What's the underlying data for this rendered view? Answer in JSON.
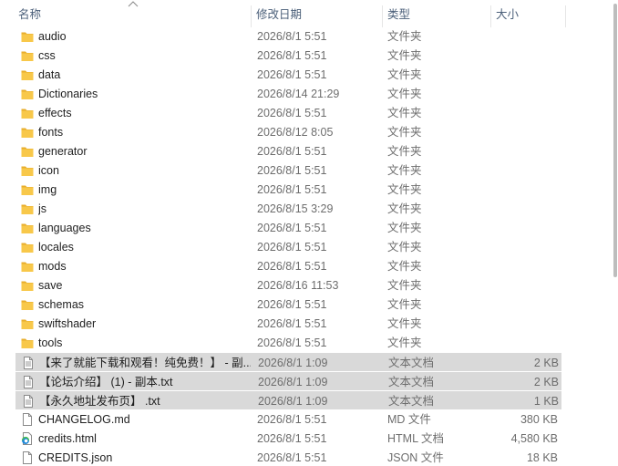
{
  "columns": {
    "name": "名称",
    "date": "修改日期",
    "type": "类型",
    "size": "大小"
  },
  "sort_indicator_icon": "sort-ascending-caret-icon",
  "colors": {
    "folder_yellow": "#f8c84a",
    "selection": "#d9d9d9",
    "header_text": "#4c607a"
  },
  "files": [
    {
      "name": "audio",
      "date": "2026/8/1 5:51",
      "type": "文件夹",
      "size": "",
      "icon": "folder-icon",
      "selected": false
    },
    {
      "name": "css",
      "date": "2026/8/1 5:51",
      "type": "文件夹",
      "size": "",
      "icon": "folder-icon",
      "selected": false
    },
    {
      "name": "data",
      "date": "2026/8/1 5:51",
      "type": "文件夹",
      "size": "",
      "icon": "folder-icon",
      "selected": false
    },
    {
      "name": "Dictionaries",
      "date": "2026/8/14 21:29",
      "type": "文件夹",
      "size": "",
      "icon": "folder-icon",
      "selected": false
    },
    {
      "name": "effects",
      "date": "2026/8/1 5:51",
      "type": "文件夹",
      "size": "",
      "icon": "folder-icon",
      "selected": false
    },
    {
      "name": "fonts",
      "date": "2026/8/12 8:05",
      "type": "文件夹",
      "size": "",
      "icon": "folder-icon",
      "selected": false
    },
    {
      "name": "generator",
      "date": "2026/8/1 5:51",
      "type": "文件夹",
      "size": "",
      "icon": "folder-icon",
      "selected": false
    },
    {
      "name": "icon",
      "date": "2026/8/1 5:51",
      "type": "文件夹",
      "size": "",
      "icon": "folder-icon",
      "selected": false
    },
    {
      "name": "img",
      "date": "2026/8/1 5:51",
      "type": "文件夹",
      "size": "",
      "icon": "folder-icon",
      "selected": false
    },
    {
      "name": "js",
      "date": "2026/8/15 3:29",
      "type": "文件夹",
      "size": "",
      "icon": "folder-icon",
      "selected": false
    },
    {
      "name": "languages",
      "date": "2026/8/1 5:51",
      "type": "文件夹",
      "size": "",
      "icon": "folder-icon",
      "selected": false
    },
    {
      "name": "locales",
      "date": "2026/8/1 5:51",
      "type": "文件夹",
      "size": "",
      "icon": "folder-icon",
      "selected": false
    },
    {
      "name": "mods",
      "date": "2026/8/1 5:51",
      "type": "文件夹",
      "size": "",
      "icon": "folder-icon",
      "selected": false
    },
    {
      "name": "save",
      "date": "2026/8/16 11:53",
      "type": "文件夹",
      "size": "",
      "icon": "folder-icon",
      "selected": false
    },
    {
      "name": "schemas",
      "date": "2026/8/1 5:51",
      "type": "文件夹",
      "size": "",
      "icon": "folder-icon",
      "selected": false
    },
    {
      "name": "swiftshader",
      "date": "2026/8/1 5:51",
      "type": "文件夹",
      "size": "",
      "icon": "folder-icon",
      "selected": false
    },
    {
      "name": "tools",
      "date": "2026/8/1 5:51",
      "type": "文件夹",
      "size": "",
      "icon": "folder-icon",
      "selected": false
    },
    {
      "name": "【来了就能下载和观看！纯免费！】 - 副...",
      "date": "2026/8/1 1:09",
      "type": "文本文档",
      "size": "2 KB",
      "icon": "text-file-icon",
      "selected": true
    },
    {
      "name": "【论坛介绍】 (1) - 副本.txt",
      "date": "2026/8/1 1:09",
      "type": "文本文档",
      "size": "2 KB",
      "icon": "text-file-icon",
      "selected": true
    },
    {
      "name": "【永久地址发布页】 .txt",
      "date": "2026/8/1 1:09",
      "type": "文本文档",
      "size": "1 KB",
      "icon": "text-file-icon",
      "selected": true
    },
    {
      "name": "CHANGELOG.md",
      "date": "2026/8/1 5:51",
      "type": "MD 文件",
      "size": "380 KB",
      "icon": "generic-file-icon",
      "selected": false
    },
    {
      "name": "credits.html",
      "date": "2026/8/1 5:51",
      "type": "HTML 文档",
      "size": "4,580 KB",
      "icon": "edge-browser-icon",
      "selected": false
    },
    {
      "name": "CREDITS.json",
      "date": "2026/8/1 5:51",
      "type": "JSON 文件",
      "size": "18 KB",
      "icon": "generic-file-icon",
      "selected": false
    }
  ]
}
